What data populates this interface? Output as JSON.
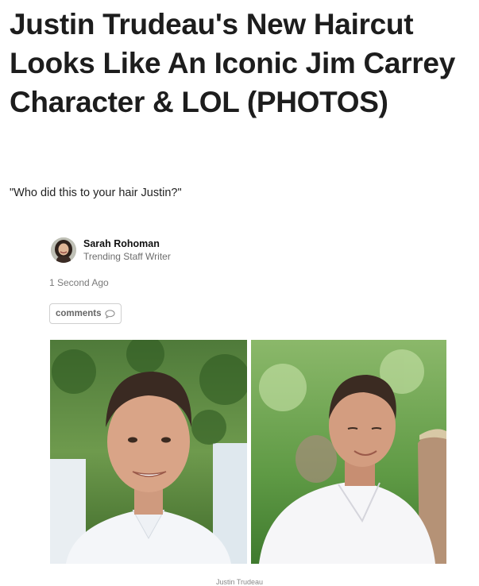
{
  "article": {
    "headline": "Justin Trudeau's New Haircut Looks Like An Iconic Jim Carrey Character & LOL (PHOTOS)",
    "subtitle": "\"Who did this to your hair Justin?\""
  },
  "author": {
    "name": "Sarah Rohoman",
    "role": "Trending Staff Writer"
  },
  "timestamp": "1 Second Ago",
  "comments": {
    "label": "comments",
    "icon": "speech-bubble-icon"
  },
  "photos": [
    {
      "name": "photo-left"
    },
    {
      "name": "photo-right"
    }
  ],
  "caption": "Justin Trudeau",
  "colors": {
    "text": "#1d1d1d",
    "muted": "#6d6d6d",
    "border": "#cfcfcf"
  }
}
